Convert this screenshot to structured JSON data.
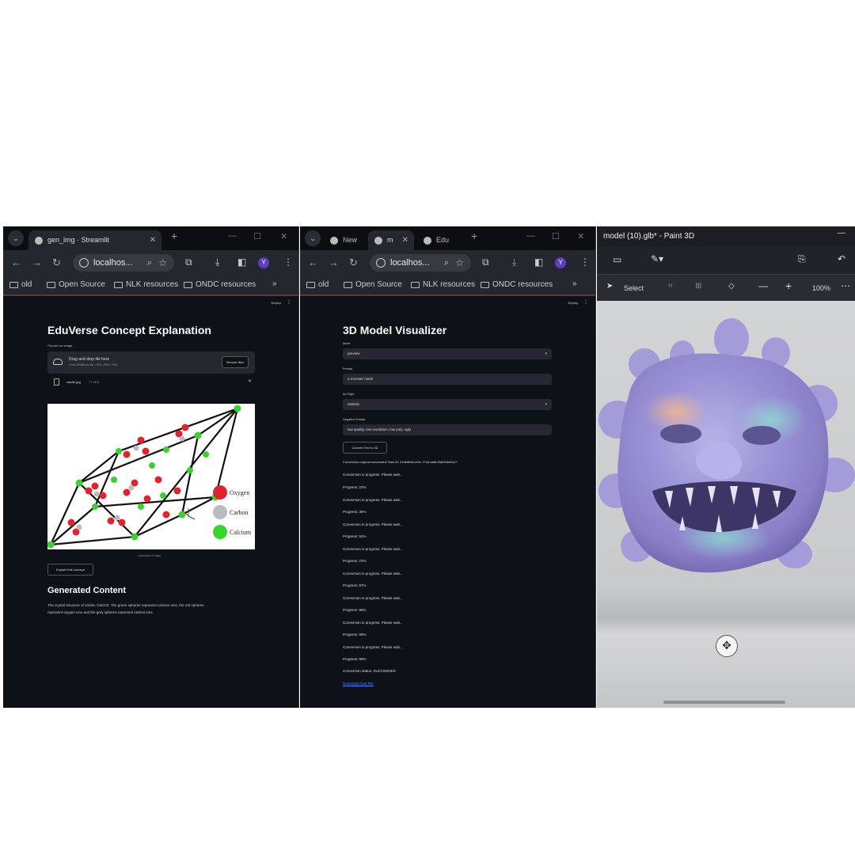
{
  "left_browser": {
    "tab_title": "gen_img · Streamlit",
    "address": "localhos...",
    "avatar_letter": "Y",
    "bookmarks": [
      "old",
      "Open Source",
      "NLK resources",
      "ONDC resources"
    ],
    "deploy_label": "Deploy",
    "page_title": "EduVerse Concept Explanation",
    "uploader_label": "Choose an image...",
    "drag_drop_text": "Drag and drop file here",
    "limit_text": "Limit 200MB per file • JPG, JPEG, PNG",
    "browse_button": "Browse files",
    "file_name": "calcite.jpg",
    "file_size": "77.4KB",
    "image_caption": "Uploaded Image",
    "legend": [
      "Oxygen",
      "Carbon",
      "Calcium"
    ],
    "explain_button": "Explain this concept",
    "generated_heading": "Generated Content",
    "generated_text_line1": "The crystal structure of calcite, CaCO3. The green spheres represent calcium ions, the red spheres",
    "generated_text_line2": "represent oxygen ions and the grey spheres represent carbon ions."
  },
  "middle_browser": {
    "tabs": [
      "New",
      "m",
      "Edu"
    ],
    "address": "localhos...",
    "avatar_letter": "Y",
    "bookmarks": [
      "old",
      "Open Source",
      "NLK resources",
      "ONDC resources"
    ],
    "deploy_label": "Deploy",
    "page_title": "3D Model Visualizer",
    "mode_label": "Mode",
    "mode_value": "preview",
    "prompt_label": "Prompt",
    "prompt_value": "a monster mask",
    "art_style_label": "Art Style",
    "art_style_value": "realistic",
    "negative_label": "Negative Prompt",
    "negative_value": "low quality, low resolution, low poly, ugly",
    "convert_button": "Convert Text to 3D",
    "log_lines": [
      "Conversion request successful! Task ID: 018e6b6b-a0fc-77db-aa8f-f9a6206a3c17",
      "Conversion in progress. Please wait...",
      "Progress: 22%",
      "Conversion in progress. Please wait...",
      "Progress: 36%",
      "Conversion in progress. Please wait...",
      "Progress: 54%",
      "Conversion in progress. Please wait...",
      "Progress: 72%",
      "Conversion in progress. Please wait...",
      "Progress: 87%",
      "Conversion in progress. Please wait...",
      "Progress: 98%",
      "Conversion in progress. Please wait...",
      "Progress: 99%",
      "Conversion in progress. Please wait...",
      "Progress: 99%",
      "Conversion status: SUCCEEDED"
    ],
    "download_link": "Download GLB File"
  },
  "paint3d": {
    "title": "model (10).glb* - Paint 3D",
    "select_label": "Select",
    "zoom": "100%"
  },
  "colors": {
    "browser_bg": "#0e1117",
    "chrome_bar": "#24272d",
    "link": "#4a8cff",
    "oxygen": "#e0242d",
    "calcium": "#39d42b",
    "carbon": "#b8bcc0"
  }
}
